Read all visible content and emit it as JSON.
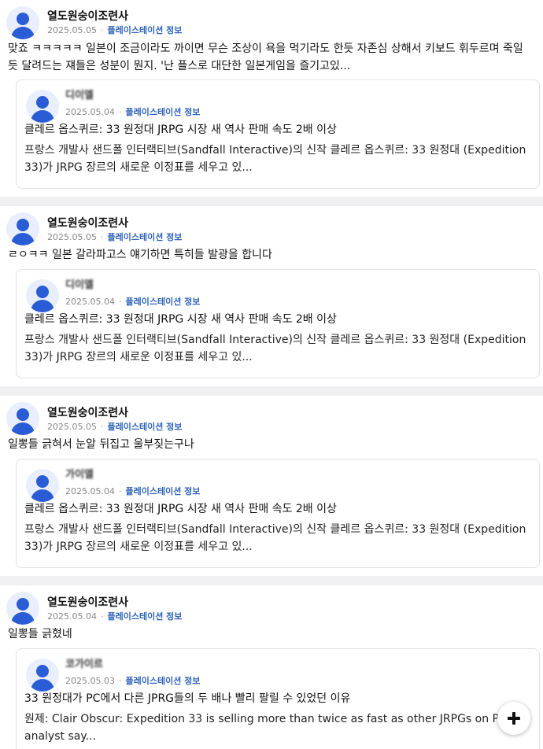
{
  "posts": [
    {
      "author": "열도원숭이조련사",
      "date": "2025.05.05",
      "category": "플레이스테이션 정보",
      "body": "맞죠 ㅋㅋㅋㅋㅋ 일본이 조금이라도 까이면 무슨 조상이 욕을 먹기라도 한듯 자존심 상해서 키보드 휘두르며 죽일듯 달려드는 쟤들은 성분이 뭔지. '난 플스로 대단한 일본게임을 즐기고있...",
      "quote": {
        "author": "디이엘",
        "date": "2025.05.04",
        "category": "플레이스테이션 정보",
        "title": "클레르 옵스퀴르: 33 원정대 JRPG 시장 새 역사 판매 속도 2배 이상",
        "desc": "프랑스 개발사 샌드폴 인터랙티브(Sandfall Interactive)의 신작 클레르 옵스퀴르: 33 원정대 (Expedition 33)가 JRPG 장르의 새로운 이정표를 세우고 있..."
      }
    },
    {
      "author": "열도원숭이조련사",
      "date": "2025.05.05",
      "category": "플레이스테이션 정보",
      "body": "ㄹㅇㅋㅋ 일본 갈라파고스 얘기하면 특히들 발광을 합니다",
      "quote": {
        "author": "디이엘",
        "date": "2025.05.04",
        "category": "플레이스테이션 정보",
        "title": "클레르 옵스퀴르: 33 원정대 JRPG 시장 새 역사 판매 속도 2배 이상",
        "desc": "프랑스 개발사 샌드폴 인터랙티브(Sandfall Interactive)의 신작 클레르 옵스퀴르: 33 원정대 (Expedition 33)가 JRPG 장르의 새로운 이정표를 세우고 있..."
      }
    },
    {
      "author": "열도원숭이조련사",
      "date": "2025.05.05",
      "category": "플레이스테이션 정보",
      "body": "일뽕들 긁혀서 눈알 뒤집고 울부짖는구나",
      "quote": {
        "author": "가이엘",
        "date": "2025.05.04",
        "category": "플레이스테이션 정보",
        "title": "클레르 옵스퀴르: 33 원정대 JRPG 시장 새 역사 판매 속도 2배 이상",
        "desc": "프랑스 개발사 샌드폴 인터랙티브(Sandfall Interactive)의 신작 클레르 옵스퀴르: 33 원정대 (Expedition 33)가 JRPG 장르의 새로운 이정표를 세우고 있..."
      }
    },
    {
      "author": "열도원숭이조련사",
      "date": "2025.05.04",
      "category": "플레이스테이션 정보",
      "body": "일뽕들 긁혔네",
      "quote": {
        "author": "코가이르",
        "date": "2025.05.03",
        "category": "플레이스테이션 정보",
        "title": "33 원정대가 PC에서 다른 JPRG들의 두 배나 빨리 팔릴 수 있었던 이유",
        "desc": "원제: Clair Obscur: Expedition 33 is selling more than twice as fast as other JRPGs on PC, analyst say..."
      }
    }
  ],
  "fab": {
    "icon": "plus-icon"
  }
}
